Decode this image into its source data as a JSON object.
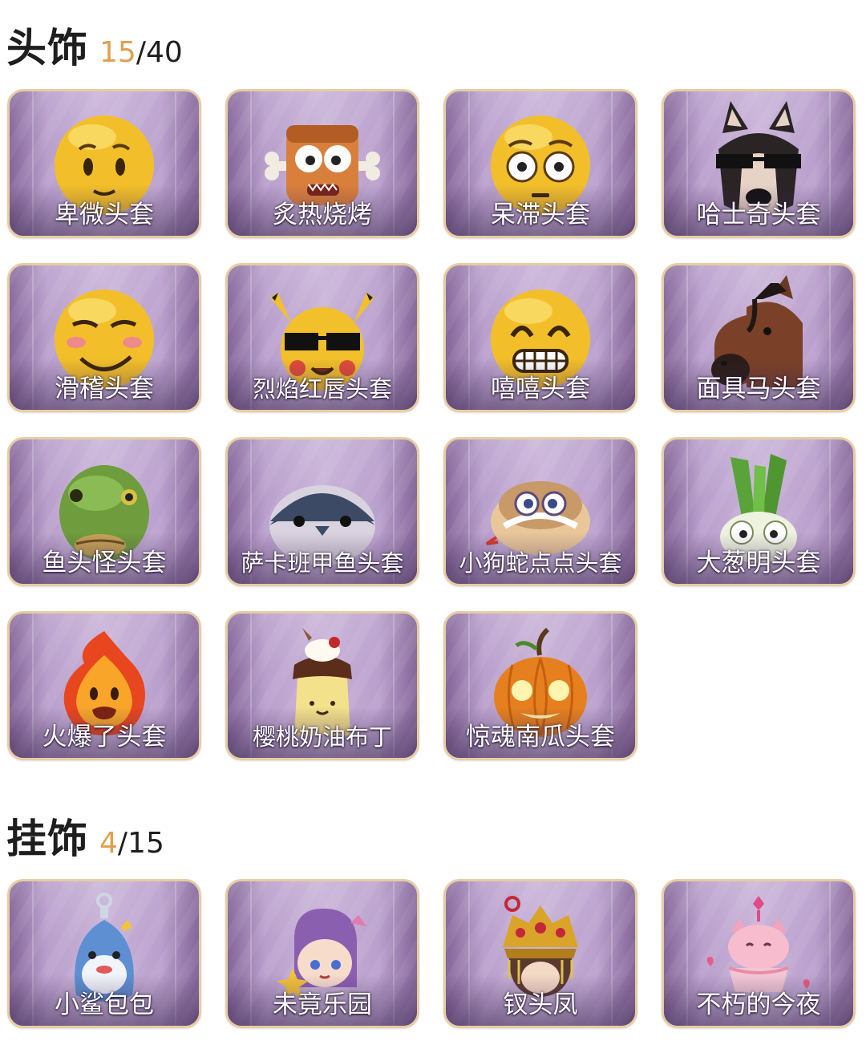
{
  "sections": [
    {
      "title": "头饰",
      "owned": "15",
      "total": "/40",
      "items": [
        {
          "name": "卑微头套",
          "icon": "shy-smiley-mask-icon"
        },
        {
          "name": "炙热烧烤",
          "icon": "bbq-box-mask-icon"
        },
        {
          "name": "呆滞头套",
          "icon": "dazed-smiley-mask-icon"
        },
        {
          "name": "哈士奇头套",
          "icon": "husky-mask-icon"
        },
        {
          "name": "滑稽头套",
          "icon": "funny-smiley-mask-icon"
        },
        {
          "name": "烈焰红唇头套",
          "icon": "yellow-mascot-mask-icon"
        },
        {
          "name": "嘻嘻头套",
          "icon": "grin-smiley-mask-icon"
        },
        {
          "name": "面具马头套",
          "icon": "horse-mask-icon"
        },
        {
          "name": "鱼头怪头套",
          "icon": "fish-head-mask-icon"
        },
        {
          "name": "萨卡班甲鱼头套",
          "icon": "sacabambaspis-mask-icon"
        },
        {
          "name": "小狗蛇点点头套",
          "icon": "snake-mask-icon"
        },
        {
          "name": "大葱明头套",
          "icon": "green-onion-mask-icon"
        },
        {
          "name": "火爆了头套",
          "icon": "fire-mask-icon"
        },
        {
          "name": "樱桃奶油布丁",
          "icon": "pudding-mask-icon"
        },
        {
          "name": "惊魂南瓜头套",
          "icon": "pumpkin-mask-icon"
        }
      ]
    },
    {
      "title": "挂饰",
      "owned": "4",
      "total": "/15",
      "items": [
        {
          "name": "小鲨包包",
          "icon": "shark-bag-icon"
        },
        {
          "name": "未竟乐园",
          "icon": "doll-charm-icon"
        },
        {
          "name": "钗头凤",
          "icon": "phoenix-crown-icon"
        },
        {
          "name": "不朽的今夜",
          "icon": "fox-cake-charm-icon"
        }
      ]
    }
  ],
  "colors": {
    "owned_count": "#e0a050",
    "card_border": "#e7cca3",
    "card_bg": "#b9a0cc"
  }
}
